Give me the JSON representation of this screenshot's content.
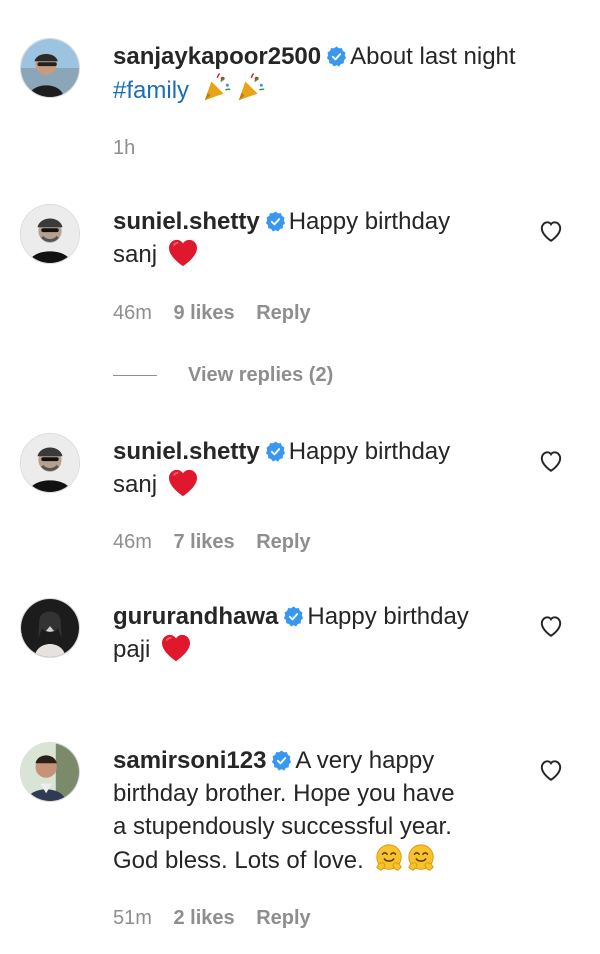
{
  "caption": {
    "username": "sanjaykapoor2500",
    "text": "About last night",
    "hashtag": "#family",
    "time": "1h"
  },
  "comments": [
    {
      "username": "suniel.shetty",
      "line1": "Happy birthday",
      "line2": "sanj",
      "time": "46m",
      "likes": "9 likes",
      "reply": "Reply"
    },
    {
      "username": "suniel.shetty",
      "line1": "Happy birthday",
      "line2": "sanj",
      "time": "46m",
      "likes": "7 likes",
      "reply": "Reply"
    },
    {
      "username": "gururandhawa",
      "line1": "Happy birthday",
      "line2": "paji"
    },
    {
      "username": "samirsoni123",
      "line1": "A very happy",
      "line2": "birthday brother. Hope you have",
      "line3": "a stupendously successful year.",
      "line4": "God bless. Lots of love.",
      "time": "51m",
      "likes": "2 likes",
      "reply": "Reply"
    }
  ],
  "view_replies": "View replies (2)",
  "colors": {
    "text": "#262626",
    "muted": "#8e8e8e",
    "verified": "#3897f0",
    "hashtag": "#1a6fb5",
    "heart": "#e0182d"
  }
}
